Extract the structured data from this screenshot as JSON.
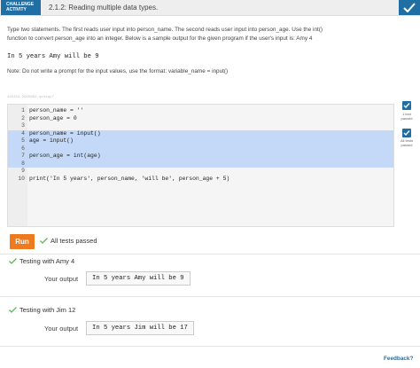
{
  "header": {
    "badge_line1": "CHALLENGE",
    "badge_line2": "ACTIVITY",
    "title": "2.1.2: Reading multiple data types.",
    "done_icon": "check-icon",
    "accent": "#1f6fa5"
  },
  "instructions": {
    "line1": "Type two statements. The first reads user input into person_name. The second reads user input into person_age. Use the int()",
    "line2": "function to convert person_age into an integer. Below is a sample output for the given program if the user's input is: Amy 4",
    "sample_output": "In 5 years Amy will be 9",
    "note": "Note: Do not write a prompt for the input values, use the format: variable_name = input()"
  },
  "editor": {
    "file_id": "445214.2915692.qx3zqy7",
    "lines": [
      {
        "num": "1",
        "code": "person_name = ''"
      },
      {
        "num": "2",
        "code": "person_age = 0"
      },
      {
        "num": "3",
        "code": ""
      },
      {
        "num": "4",
        "code": "person_name = input()"
      },
      {
        "num": "5",
        "code": "age = input()"
      },
      {
        "num": "6",
        "code": ""
      },
      {
        "num": "7",
        "code": "person_age = int(age)"
      },
      {
        "num": "8",
        "code": ""
      },
      {
        "num": "9",
        "code": ""
      },
      {
        "num": "10",
        "code": "print('In 5 years', person_name, 'will be', person_age + 5)"
      }
    ]
  },
  "side_checks": [
    {
      "label_line1": "1 test",
      "label_line2": "passed"
    },
    {
      "label_line1": "All tests",
      "label_line2": "passed"
    }
  ],
  "run": {
    "button_label": "Run",
    "status": "All tests passed"
  },
  "tests": [
    {
      "title": "Testing with Amy 4",
      "output_label": "Your output",
      "output": "In 5 years Amy will be 9"
    },
    {
      "title": "Testing with Jim 12",
      "output_label": "Your output",
      "output": "In 5 years Jim will be 17"
    }
  ],
  "footer": {
    "feedback_label": "Feedback?"
  },
  "colors": {
    "success": "#5cb85c",
    "run_button": "#ee7a20",
    "highlight": "#c4d9f7"
  }
}
